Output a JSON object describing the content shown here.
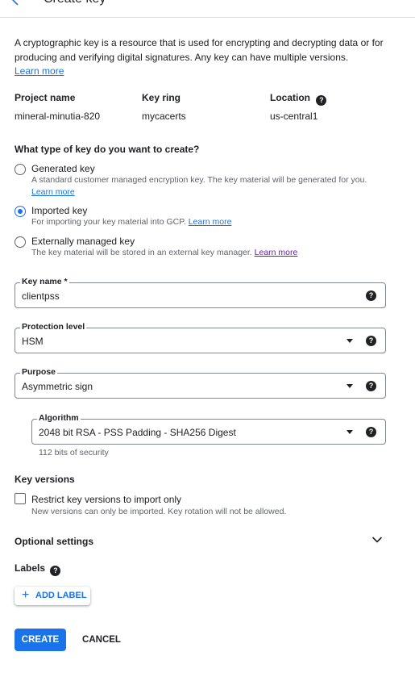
{
  "header": {
    "title": "Create key"
  },
  "intro": {
    "text": "A cryptographic key is a resource that is used for encrypting and decrypting data or for producing and verifying digital signatures. Any key can have multiple versions.",
    "learn_more": "Learn more"
  },
  "info": {
    "project_label": "Project name",
    "project_value": "mineral-minutia-820",
    "keyring_label": "Key ring",
    "keyring_value": "mycacerts",
    "location_label": "Location",
    "location_value": "us-central1"
  },
  "key_type": {
    "question": "What type of key do you want to create?",
    "options": [
      {
        "label": "Generated key",
        "desc": "A standard customer managed encryption key. The key material will be generated for you.",
        "link": "Learn more",
        "checked": false
      },
      {
        "label": "Imported key",
        "desc": "For importing your key material into GCP.",
        "link": "Learn more",
        "checked": true
      },
      {
        "label": "Externally managed key",
        "desc": "The key material will be stored in an external key manager.",
        "link": "Learn more",
        "checked": false
      }
    ]
  },
  "fields": {
    "key_name": {
      "label": "Key name *",
      "value": "clientpss"
    },
    "protection_level": {
      "label": "Protection level",
      "value": "HSM"
    },
    "purpose": {
      "label": "Purpose",
      "value": "Asymmetric sign"
    },
    "algorithm": {
      "label": "Algorithm",
      "value": "2048 bit RSA - PSS Padding - SHA256 Digest",
      "hint": "112 bits of security"
    }
  },
  "key_versions": {
    "title": "Key versions",
    "checkbox_label": "Restrict key versions to import only",
    "checkbox_desc": "New versions can only be imported. Key rotation will not be allowed."
  },
  "optional_settings": "Optional settings",
  "labels": {
    "title": "Labels",
    "add_button": "ADD LABEL"
  },
  "actions": {
    "create": "CREATE",
    "cancel": "CANCEL"
  },
  "colors": {
    "accent": "#1a73e8",
    "visited_link": "#681da8"
  }
}
